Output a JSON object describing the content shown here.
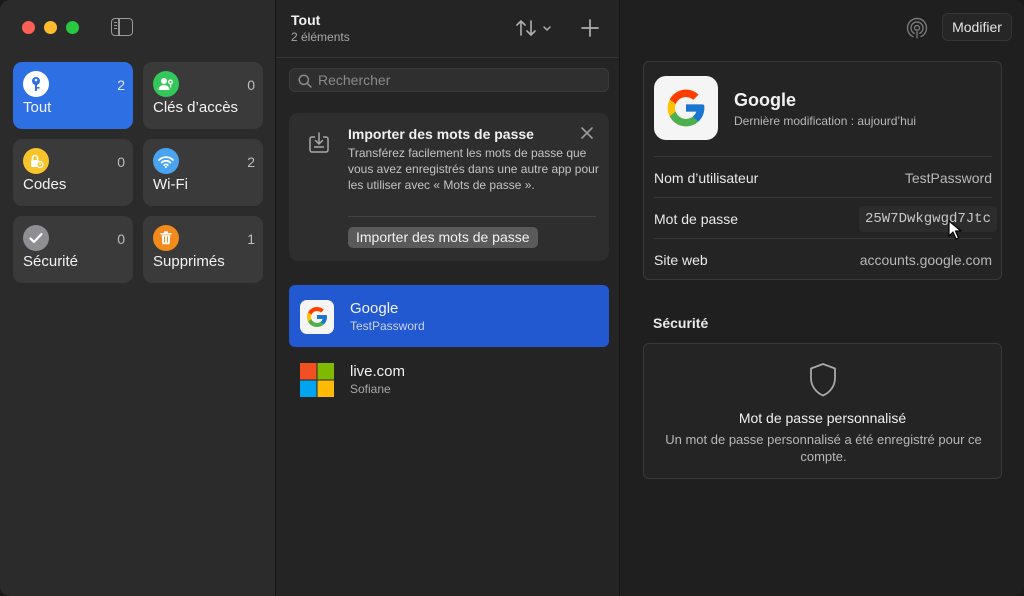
{
  "sidebar": {
    "tiles": [
      {
        "label": "Tout",
        "count": "2",
        "color": "#2f6fe4",
        "icon": "key-icon"
      },
      {
        "label": "Clés d’accès",
        "count": "0",
        "color": "#34c759",
        "icon": "passkey-person-icon"
      },
      {
        "label": "Codes",
        "count": "0",
        "color": "#f7c52b",
        "icon": "lock-clock-icon"
      },
      {
        "label": "Wi-Fi",
        "count": "2",
        "color": "#4aa3f0",
        "icon": "wifi-icon"
      },
      {
        "label": "Sécurité",
        "count": "0",
        "color": "#8e8e93",
        "icon": "checkmark-icon"
      },
      {
        "label": "Supprimés",
        "count": "1",
        "color": "#f28b1c",
        "icon": "trash-icon"
      }
    ]
  },
  "list": {
    "title": "Tout",
    "subtitle": "2 éléments",
    "search_placeholder": "Rechercher",
    "import_card": {
      "title": "Importer des mots de passe",
      "description": "Transférez facilement les mots de passe que vous avez enregistrés dans une autre app pour les utiliser avec « Mots de passe ».",
      "button": "Importer des mots de passe"
    },
    "entries": [
      {
        "name": "Google",
        "user": "TestPassword",
        "selected": true
      },
      {
        "name": "live.com",
        "user": "Sofiane",
        "selected": false
      }
    ]
  },
  "detail": {
    "edit_label": "Modifier",
    "app_name": "Google",
    "modified": "Dernière modification : aujourd’hui",
    "rows": {
      "username_label": "Nom d’utilisateur",
      "username_value": "TestPassword",
      "password_label": "Mot de passe",
      "password_value": "25W7Dwkgwgd7Jtc",
      "website_label": "Site web",
      "website_value": "accounts.google.com"
    },
    "security": {
      "heading": "Sécurité",
      "title": "Mot de passe personnalisé",
      "description": "Un mot de passe personnalisé a été enregistré pour ce compte."
    }
  }
}
